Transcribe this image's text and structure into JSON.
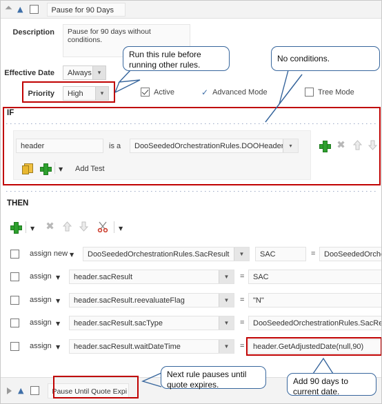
{
  "rule_header": {
    "name": "Pause for 90 Days",
    "expand_icon": "triangle-expanded-icon",
    "collapse_icon": "double-chevron-up-icon",
    "select_checkbox": false
  },
  "form": {
    "description_label": "Description",
    "description_value": "Pause for 90 days without conditions.",
    "effective_date_label": "Effective Date",
    "effective_date_value": "Always",
    "priority_label": "Priority",
    "priority_value": "High",
    "active_label": "Active",
    "active_checked": true,
    "advanced_mode_label": "Advanced Mode",
    "advanced_mode_checked": true,
    "tree_mode_label": "Tree Mode",
    "tree_mode_checked": false
  },
  "if_section": {
    "title": "IF",
    "pattern_var": "header",
    "is_a_label": "is a",
    "fact_type": "DooSeededOrchestrationRules.DOOHeader",
    "add_test_label": "Add Test",
    "toolbar_icons": [
      "add-icon",
      "delete-icon",
      "move-up-icon",
      "move-down-icon"
    ],
    "footer_icons": [
      "copy-icon",
      "add-icon",
      "dropdown-caret-icon"
    ]
  },
  "then_section": {
    "title": "THEN",
    "toolbar_icons": [
      "add-icon",
      "add-dropdown-caret-icon",
      "delete-icon",
      "move-up-icon",
      "move-down-icon",
      "cut-icon",
      "cut-dropdown-caret-icon"
    ],
    "equals_label": "=",
    "rows": [
      {
        "checked": false,
        "action": "assign new",
        "target": "DooSeededOrchestrationRules.SacResult",
        "alias": "SAC",
        "value": "DooSeededOrchest"
      },
      {
        "checked": false,
        "action": "assign",
        "target": "header.sacResult",
        "alias": null,
        "value": "SAC"
      },
      {
        "checked": false,
        "action": "assign",
        "target": "header.sacResult.reevaluateFlag",
        "alias": null,
        "value": "\"N\""
      },
      {
        "checked": false,
        "action": "assign",
        "target": "header.sacResult.sacType",
        "alias": null,
        "value": "DooSeededOrchestrationRules.SacResult"
      },
      {
        "checked": false,
        "action": "assign",
        "target": "header.sacResult.waitDateTime",
        "alias": null,
        "value": "header.GetAdjustedDate(null,90)",
        "highlighted": true
      }
    ]
  },
  "bottom_rule": {
    "name": "Pause Until Quote Expi",
    "expand_icon": "triangle-collapsed-icon",
    "collapse_icon": "double-chevron-up-icon",
    "select_checkbox": false
  },
  "callouts": [
    {
      "id": "priority-callout",
      "text": "Run this rule before\nrunning other rules."
    },
    {
      "id": "no-conditions-callout",
      "text": "No conditions."
    },
    {
      "id": "next-rule-callout",
      "text": "Next rule pauses until\nquote expires."
    },
    {
      "id": "add-days-callout",
      "text": "Add 90 days to\ncurrent date."
    }
  ],
  "colors": {
    "highlight_red": "#c00000",
    "callout_blue": "#36659c",
    "add_green": "#2ea02e",
    "accent_blue": "#3f6fa8"
  }
}
